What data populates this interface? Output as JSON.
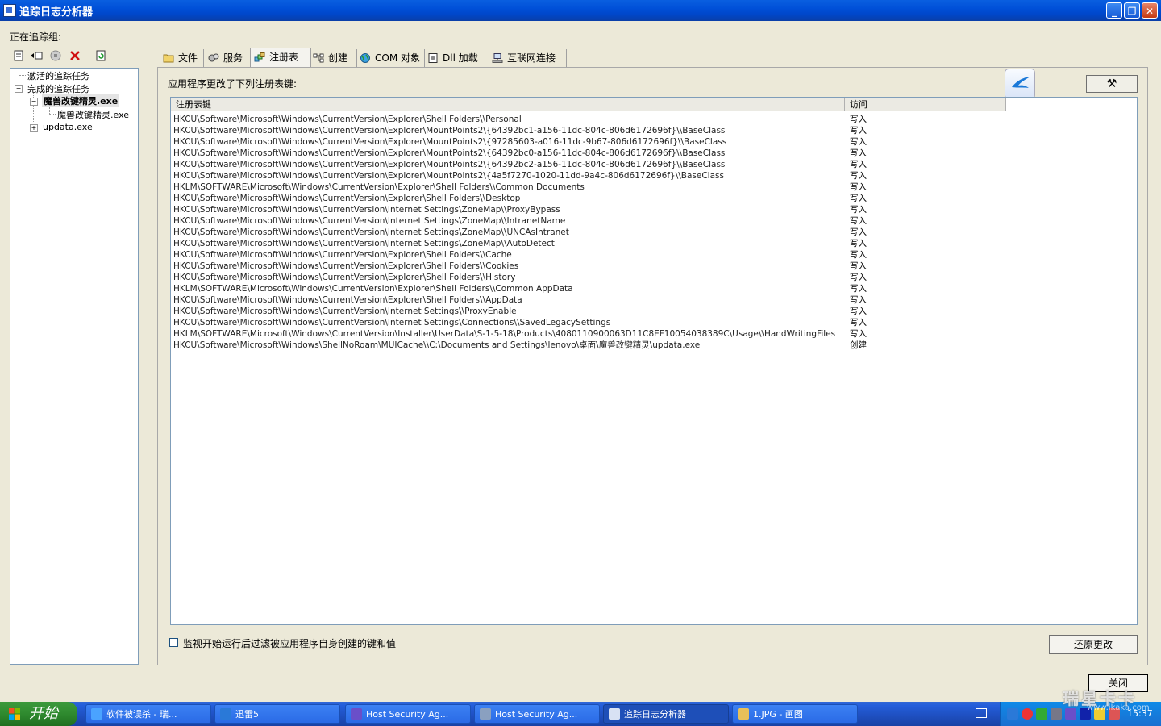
{
  "window": {
    "title": "追踪日志分析器"
  },
  "left": {
    "label": "正在追踪组:",
    "tree": {
      "active": "激活的追踪任务",
      "completed": "完成的追踪任务",
      "selected": "魔兽改键精灵.exe",
      "child": "魔兽改键精灵.exe",
      "other": "updata.exe"
    }
  },
  "tabs": [
    {
      "label": "文件",
      "icon": "folder-icon"
    },
    {
      "label": "服务",
      "icon": "gears-icon"
    },
    {
      "label": "注册表",
      "icon": "registry-icon"
    },
    {
      "label": "创建",
      "icon": "tree-icon"
    },
    {
      "label": "COM 对象",
      "icon": "globe-icon"
    },
    {
      "label": "Dll 加载",
      "icon": "dll-icon"
    },
    {
      "label": "互联网连接",
      "icon": "network-icon"
    }
  ],
  "panel": {
    "label": "应用程序更改了下列注册表键:",
    "columns": [
      "注册表键",
      "访问"
    ],
    "rows": [
      [
        "HKCU\\Software\\Microsoft\\Windows\\CurrentVersion\\Explorer\\Shell Folders\\\\Personal",
        "写入"
      ],
      [
        "HKCU\\Software\\Microsoft\\Windows\\CurrentVersion\\Explorer\\MountPoints2\\{64392bc1-a156-11dc-804c-806d6172696f}\\\\BaseClass",
        "写入"
      ],
      [
        "HKCU\\Software\\Microsoft\\Windows\\CurrentVersion\\Explorer\\MountPoints2\\{97285603-a016-11dc-9b67-806d6172696f}\\\\BaseClass",
        "写入"
      ],
      [
        "HKCU\\Software\\Microsoft\\Windows\\CurrentVersion\\Explorer\\MountPoints2\\{64392bc0-a156-11dc-804c-806d6172696f}\\\\BaseClass",
        "写入"
      ],
      [
        "HKCU\\Software\\Microsoft\\Windows\\CurrentVersion\\Explorer\\MountPoints2\\{64392bc2-a156-11dc-804c-806d6172696f}\\\\BaseClass",
        "写入"
      ],
      [
        "HKCU\\Software\\Microsoft\\Windows\\CurrentVersion\\Explorer\\MountPoints2\\{4a5f7270-1020-11dd-9a4c-806d6172696f}\\\\BaseClass",
        "写入"
      ],
      [
        "HKLM\\SOFTWARE\\Microsoft\\Windows\\CurrentVersion\\Explorer\\Shell Folders\\\\Common Documents",
        "写入"
      ],
      [
        "HKCU\\Software\\Microsoft\\Windows\\CurrentVersion\\Explorer\\Shell Folders\\\\Desktop",
        "写入"
      ],
      [
        "HKCU\\Software\\Microsoft\\Windows\\CurrentVersion\\Internet Settings\\ZoneMap\\\\ProxyBypass",
        "写入"
      ],
      [
        "HKCU\\Software\\Microsoft\\Windows\\CurrentVersion\\Internet Settings\\ZoneMap\\\\IntranetName",
        "写入"
      ],
      [
        "HKCU\\Software\\Microsoft\\Windows\\CurrentVersion\\Internet Settings\\ZoneMap\\\\UNCAsIntranet",
        "写入"
      ],
      [
        "HKCU\\Software\\Microsoft\\Windows\\CurrentVersion\\Internet Settings\\ZoneMap\\\\AutoDetect",
        "写入"
      ],
      [
        "HKCU\\Software\\Microsoft\\Windows\\CurrentVersion\\Explorer\\Shell Folders\\\\Cache",
        "写入"
      ],
      [
        "HKCU\\Software\\Microsoft\\Windows\\CurrentVersion\\Explorer\\Shell Folders\\\\Cookies",
        "写入"
      ],
      [
        "HKCU\\Software\\Microsoft\\Windows\\CurrentVersion\\Explorer\\Shell Folders\\\\History",
        "写入"
      ],
      [
        "HKLM\\SOFTWARE\\Microsoft\\Windows\\CurrentVersion\\Explorer\\Shell Folders\\\\Common AppData",
        "写入"
      ],
      [
        "HKCU\\Software\\Microsoft\\Windows\\CurrentVersion\\Explorer\\Shell Folders\\\\AppData",
        "写入"
      ],
      [
        "HKCU\\Software\\Microsoft\\Windows\\CurrentVersion\\Internet Settings\\\\ProxyEnable",
        "写入"
      ],
      [
        "HKCU\\Software\\Microsoft\\Windows\\CurrentVersion\\Internet Settings\\Connections\\\\SavedLegacySettings",
        "写入"
      ],
      [
        "HKLM\\SOFTWARE\\Microsoft\\Windows\\CurrentVersion\\Installer\\UserData\\S-1-5-18\\Products\\4080110900063D11C8EF10054038389C\\Usage\\\\HandWritingFiles",
        "写入"
      ],
      [
        "HKCU\\Software\\Microsoft\\Windows\\ShellNoRoam\\MUICache\\\\C:\\Documents and Settings\\lenovo\\桌面\\魔兽改键精灵\\updata.exe",
        "创建"
      ]
    ],
    "checkbox_label": "监视开始运行后过滤被应用程序自身创建的键和值",
    "restore_label": "还原更改"
  },
  "close_label": "关闭",
  "taskbar": {
    "start": "开始",
    "tasks": [
      {
        "label": "软件被误杀 - 瑞...",
        "icon": "ie-icon",
        "color": "#4aa3ff"
      },
      {
        "label": "迅雷5",
        "icon": "thunder-icon",
        "color": "#2a79d8"
      },
      {
        "label": "Host Security Ag...",
        "icon": "shield-icon",
        "color": "#6a4fc9"
      },
      {
        "label": "Host Security Ag...",
        "icon": "gear-icon",
        "color": "#8aa0c0"
      },
      {
        "label": "追踪日志分析器",
        "icon": "log-analyzer-icon",
        "color": "#d8e2f4"
      },
      {
        "label": "1.JPG - 画图",
        "icon": "paint-icon",
        "color": "#e8c05a"
      }
    ],
    "clock": "15:37"
  },
  "watermark": {
    "main": "瑞星卡卡",
    "sub": "www.ikaka.com"
  }
}
